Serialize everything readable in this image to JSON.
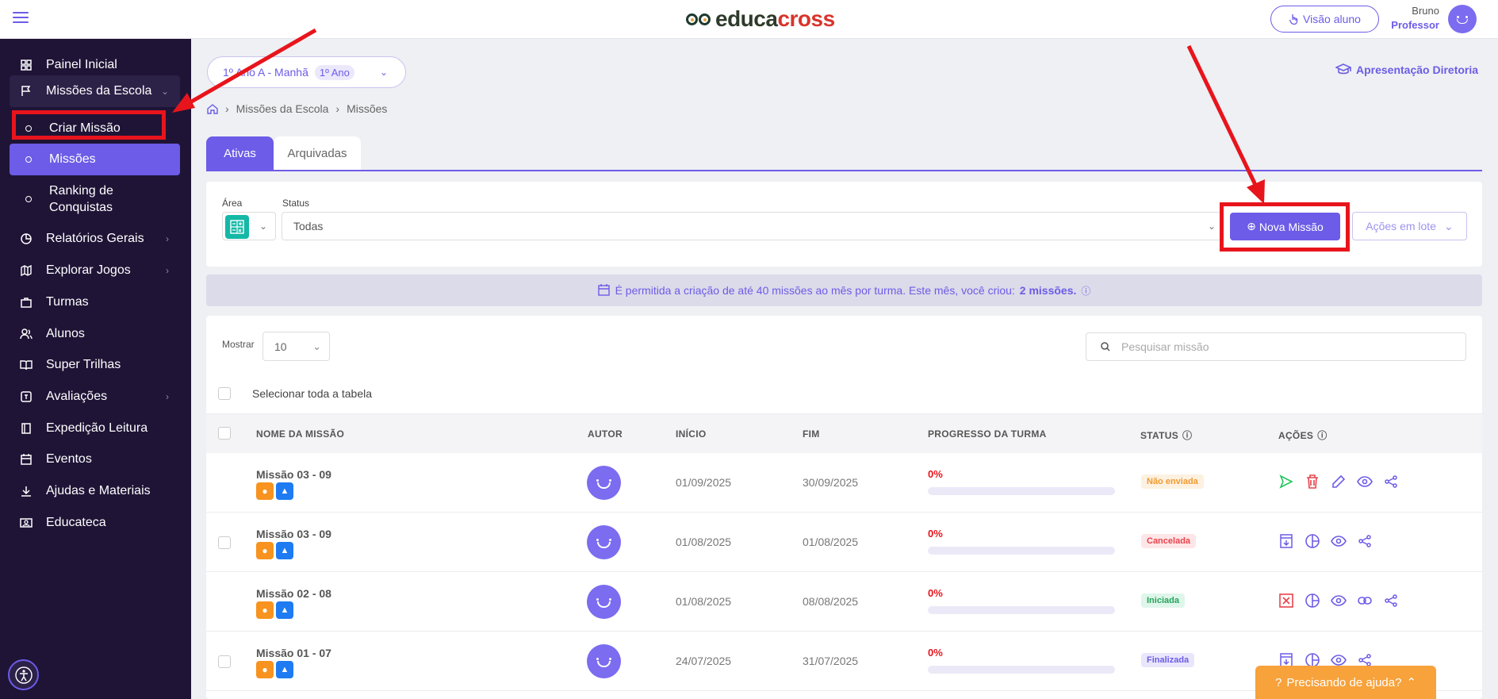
{
  "header": {
    "logo_part1": "educa",
    "logo_part2": "cross",
    "visao_aluno_label": "Visão aluno",
    "user_name": "Bruno",
    "user_role": "Professor"
  },
  "sidebar": {
    "items": [
      {
        "label": "Painel Inicial",
        "icon": "grid-icon"
      },
      {
        "label": "Missões da Escola",
        "icon": "flag-icon"
      },
      {
        "label": "Criar Missão"
      },
      {
        "label": "Missões"
      },
      {
        "label": "Ranking de Conquistas"
      },
      {
        "label": "Relatórios Gerais",
        "icon": "pie-chart-icon"
      },
      {
        "label": "Explorar Jogos",
        "icon": "map-icon"
      },
      {
        "label": "Turmas",
        "icon": "briefcase-icon"
      },
      {
        "label": "Alunos",
        "icon": "users-icon"
      },
      {
        "label": "Super Trilhas",
        "icon": "book-open-icon"
      },
      {
        "label": "Avaliações",
        "icon": "clipboard-icon"
      },
      {
        "label": "Expedição Leitura",
        "icon": "book-icon"
      },
      {
        "label": "Eventos",
        "icon": "calendar-icon"
      },
      {
        "label": "Ajudas e Materiais",
        "icon": "download-icon"
      },
      {
        "label": "Educateca",
        "icon": "id-card-icon"
      }
    ]
  },
  "class_selector": {
    "value": "1º Ano A - Manhã",
    "pill": "1º Ano"
  },
  "diretoria_link": "Apresentação Diretoria",
  "breadcrumb": [
    "Missões da Escola",
    "Missões"
  ],
  "tabs": [
    {
      "label": "Ativas",
      "active": true
    },
    {
      "label": "Arquivadas",
      "active": false
    }
  ],
  "filters": {
    "area_label": "Área",
    "status_label": "Status",
    "status_value": "Todas",
    "nova_missao_label": "Nova Missão",
    "acoes_lote_label": "Ações em lote"
  },
  "info_bar": {
    "text": "É permitida a criação de até 40 missões ao mês por turma. Este mês, você criou:",
    "count": "2 missões."
  },
  "table": {
    "mostrar_label": "Mostrar",
    "mostrar_value": "10",
    "search_placeholder": "Pesquisar missão",
    "select_all_label": "Selecionar toda a tabela",
    "columns": [
      "NOME DA MISSÃO",
      "AUTOR",
      "INÍCIO",
      "FIM",
      "PROGRESSO DA TURMA",
      "STATUS",
      "AÇÕES"
    ],
    "rows": [
      {
        "name": "Missão 03 - 09",
        "start": "01/09/2025",
        "end": "30/09/2025",
        "progress": "0%",
        "progress_value": 0,
        "status": "Não enviada",
        "status_bg": "#fdf1e1",
        "status_color": "#f29a2e",
        "has_checkbox": false
      },
      {
        "name": "Missão 03 - 09",
        "start": "01/08/2025",
        "end": "01/08/2025",
        "progress": "0%",
        "progress_value": 0,
        "status": "Cancelada",
        "status_bg": "#fde6e7",
        "status_color": "#e8434b",
        "has_checkbox": true
      },
      {
        "name": "Missão 02 - 08",
        "start": "01/08/2025",
        "end": "08/08/2025",
        "progress": "0%",
        "progress_value": 0,
        "status": "Iniciada",
        "status_bg": "#dff6ea",
        "status_color": "#22a35a",
        "has_checkbox": false
      },
      {
        "name": "Missão 01 - 07",
        "start": "24/07/2025",
        "end": "31/07/2025",
        "progress": "0%",
        "progress_value": 0,
        "status": "Finalizada",
        "status_bg": "#e9e6fb",
        "status_color": "#6c5ce7",
        "has_checkbox": true
      }
    ]
  },
  "help_button": "Precisando de ajuda?",
  "colors": {
    "accent": "#6c5ce7",
    "sidebar_bg": "#1f1436",
    "annotation_red": "#e8141c"
  }
}
